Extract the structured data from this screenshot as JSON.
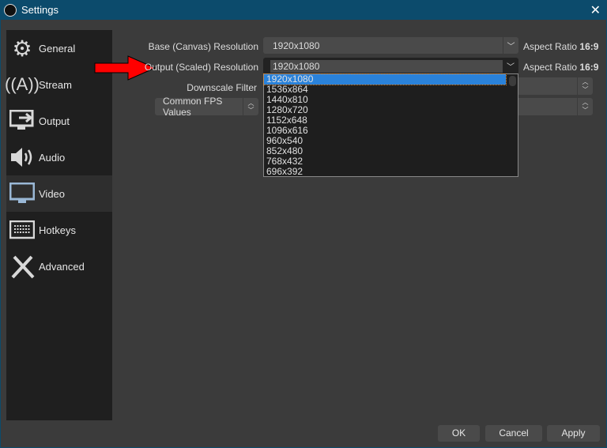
{
  "window": {
    "title": "Settings",
    "close": "✕"
  },
  "sidebar": {
    "items": [
      {
        "label": "General",
        "icon": "gear-icon"
      },
      {
        "label": "Stream",
        "icon": "broadcast-icon"
      },
      {
        "label": "Output",
        "icon": "output-icon"
      },
      {
        "label": "Audio",
        "icon": "speaker-icon"
      },
      {
        "label": "Video",
        "icon": "monitor-icon"
      },
      {
        "label": "Hotkeys",
        "icon": "keyboard-icon"
      },
      {
        "label": "Advanced",
        "icon": "tools-icon"
      }
    ]
  },
  "video": {
    "base_label": "Base (Canvas) Resolution",
    "base_value": "1920x1080",
    "output_label": "Output (Scaled) Resolution",
    "output_value": "1920x1080",
    "aspect_label": "Aspect Ratio",
    "aspect_base": "16:9",
    "aspect_output": "16:9",
    "downscale_label": "Downscale Filter",
    "fps_label": "Common FPS Values",
    "dropdown_options": [
      "1920x1080",
      "1536x864",
      "1440x810",
      "1280x720",
      "1152x648",
      "1096x616",
      "960x540",
      "852x480",
      "768x432",
      "696x392"
    ]
  },
  "buttons": {
    "ok": "OK",
    "cancel": "Cancel",
    "apply": "Apply"
  },
  "colors": {
    "titlebar": "#0c4b6c",
    "selection": "#2a82da",
    "arrow": "#ff0000"
  }
}
